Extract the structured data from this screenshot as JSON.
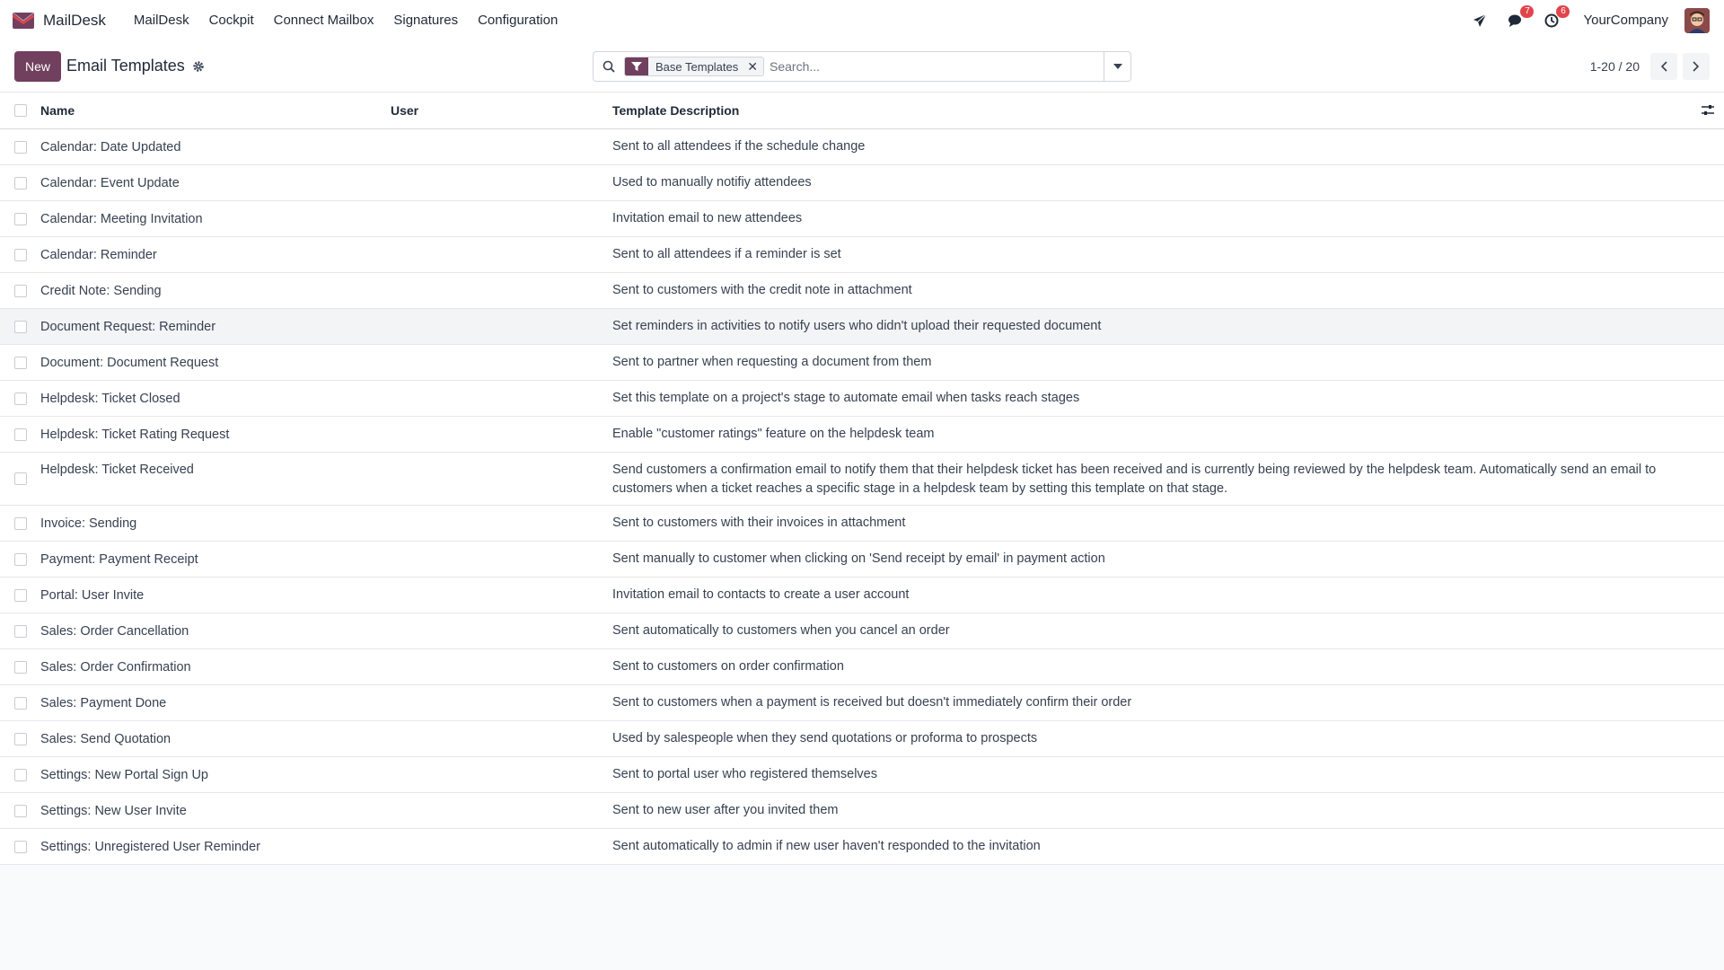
{
  "app": {
    "name": "MailDesk",
    "menu": [
      "MailDesk",
      "Cockpit",
      "Connect Mailbox",
      "Signatures",
      "Configuration"
    ],
    "company": "YourCompany",
    "messages_badge": "7",
    "activities_badge": "6",
    "brand_color": "#71405f",
    "badge_color": "#e0454c"
  },
  "control": {
    "new_label": "New",
    "title": "Email Templates",
    "facet_label": "Base Templates",
    "search_placeholder": "Search...",
    "pager": "1-20 / 20"
  },
  "table": {
    "headers": {
      "name": "Name",
      "user": "User",
      "description": "Template Description"
    },
    "rows": [
      {
        "name": "Calendar: Date Updated",
        "user": "",
        "description": "Sent to all attendees if the schedule change"
      },
      {
        "name": "Calendar: Event Update",
        "user": "",
        "description": "Used to manually notifiy attendees"
      },
      {
        "name": "Calendar: Meeting Invitation",
        "user": "",
        "description": "Invitation email to new attendees"
      },
      {
        "name": "Calendar: Reminder",
        "user": "",
        "description": "Sent to all attendees if a reminder is set"
      },
      {
        "name": "Credit Note: Sending",
        "user": "",
        "description": "Sent to customers with the credit note in attachment"
      },
      {
        "name": "Document Request: Reminder",
        "user": "",
        "description": "Set reminders in activities to notify users who didn't upload their requested document"
      },
      {
        "name": "Document: Document Request",
        "user": "",
        "description": "Sent to partner when requesting a document from them"
      },
      {
        "name": "Helpdesk: Ticket Closed",
        "user": "",
        "description": "Set this template on a project's stage to automate email when tasks reach stages"
      },
      {
        "name": "Helpdesk: Ticket Rating Request",
        "user": "",
        "description": "Enable \"customer ratings\" feature on the helpdesk team"
      },
      {
        "name": "Helpdesk: Ticket Received",
        "user": "",
        "description": "Send customers a confirmation email to notify them that their helpdesk ticket has been received and is currently being reviewed by the helpdesk team. Automatically send an email to customers when a ticket reaches a specific stage in a helpdesk team by setting this template on that stage."
      },
      {
        "name": "Invoice: Sending",
        "user": "",
        "description": "Sent to customers with their invoices in attachment"
      },
      {
        "name": "Payment: Payment Receipt",
        "user": "",
        "description": "Sent manually to customer when clicking on 'Send receipt by email' in payment action"
      },
      {
        "name": "Portal: User Invite",
        "user": "",
        "description": "Invitation email to contacts to create a user account"
      },
      {
        "name": "Sales: Order Cancellation",
        "user": "",
        "description": "Sent automatically to customers when you cancel an order"
      },
      {
        "name": "Sales: Order Confirmation",
        "user": "",
        "description": "Sent to customers on order confirmation"
      },
      {
        "name": "Sales: Payment Done",
        "user": "",
        "description": "Sent to customers when a payment is received but doesn't immediately confirm their order"
      },
      {
        "name": "Sales: Send Quotation",
        "user": "",
        "description": "Used by salespeople when they send quotations or proforma to prospects"
      },
      {
        "name": "Settings: New Portal Sign Up",
        "user": "",
        "description": "Sent to portal user who registered themselves"
      },
      {
        "name": "Settings: New User Invite",
        "user": "",
        "description": "Sent to new user after you invited them"
      },
      {
        "name": "Settings: Unregistered User Reminder",
        "user": "",
        "description": "Sent automatically to admin if new user haven't responded to the invitation"
      }
    ]
  }
}
